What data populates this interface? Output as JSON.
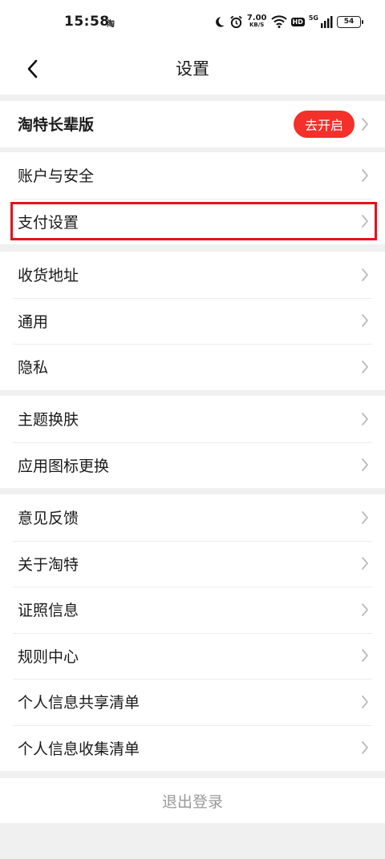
{
  "status_bar": {
    "time": "15:58",
    "app_icon_text": "淘",
    "net_speed_value": "7.00",
    "net_speed_unit": "KB/S",
    "hd_label": "HD",
    "network_label": "5G",
    "battery": "54",
    "icons": [
      "moon-icon",
      "alarm-icon",
      "wifi-icon",
      "hd-icon",
      "signal-icon",
      "battery-icon"
    ]
  },
  "header": {
    "title": "设置",
    "back_icon": "chevron-left-icon"
  },
  "groups": [
    {
      "items": [
        {
          "label": "淘特长辈版",
          "action_label": "去开启"
        }
      ]
    },
    {
      "items": [
        {
          "label": "账户与安全"
        },
        {
          "label": "支付设置"
        }
      ]
    },
    {
      "items": [
        {
          "label": "收货地址"
        },
        {
          "label": "通用"
        },
        {
          "label": "隐私"
        }
      ]
    },
    {
      "items": [
        {
          "label": "主题换肤"
        },
        {
          "label": "应用图标更换"
        }
      ]
    },
    {
      "items": [
        {
          "label": "意见反馈"
        },
        {
          "label": "关于淘特"
        },
        {
          "label": "证照信息"
        },
        {
          "label": "规则中心"
        },
        {
          "label": "个人信息共享清单"
        },
        {
          "label": "个人信息收集清单"
        }
      ]
    }
  ],
  "logout_label": "退出登录",
  "colors": {
    "accent": "#f3302a",
    "highlight_box": "#e8101a",
    "background": "#f0f0f0"
  }
}
